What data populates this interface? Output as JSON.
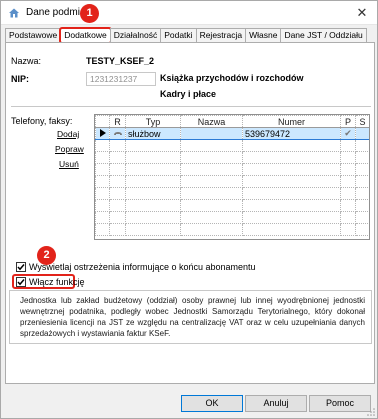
{
  "window": {
    "title": "Dane podmi"
  },
  "callouts": [
    "1",
    "2"
  ],
  "tabs": [
    {
      "label": "Podstawowe"
    },
    {
      "label": "Dodatkowe"
    },
    {
      "label": "Działalność"
    },
    {
      "label": "Podatki"
    },
    {
      "label": "Rejestracja"
    },
    {
      "label": "Własne"
    },
    {
      "label": "Dane JST / Oddziału"
    }
  ],
  "form": {
    "name_label": "Nazwa:",
    "name_value": "TESTY_KSEF_2",
    "nip_label": "NIP:",
    "nip_value": "1231231237",
    "book_type": "Książka przychodów i rozchodów",
    "payroll": "Kadry i płace"
  },
  "phones": {
    "label": "Telefony, faksy:",
    "links": {
      "add": "Dodaj",
      "edit": "Popraw",
      "delete": "Usuń"
    },
    "columns": [
      "R",
      "Typ",
      "Nazwa",
      "Numer",
      "P",
      "S"
    ],
    "rows": [
      {
        "typ": "służbow",
        "nazwa": "",
        "numer": "539679472",
        "p": "✔",
        "s": ""
      }
    ]
  },
  "options": {
    "warnings_label": "Wyświetlaj ostrzeżenia informujące o końcu abonamentu",
    "warnings_checked": true,
    "enable_label": "Włącz funkcję",
    "enable_checked": true,
    "description": "Jednostka lub zakład budżetowy (oddział) osoby prawnej lub innej wyodrębnionej jednostki wewnętrznej podatnika, podległy wobec Jednostki Samorządu Terytorialnego, który dokonał przeniesienia licencji na JST ze względu na centralizację VAT oraz w celu uzupełniania danych sprzedażowych i wystawiania faktur KSeF."
  },
  "buttons": {
    "ok": "OK",
    "cancel": "Anuluj",
    "help": "Pomoc"
  }
}
